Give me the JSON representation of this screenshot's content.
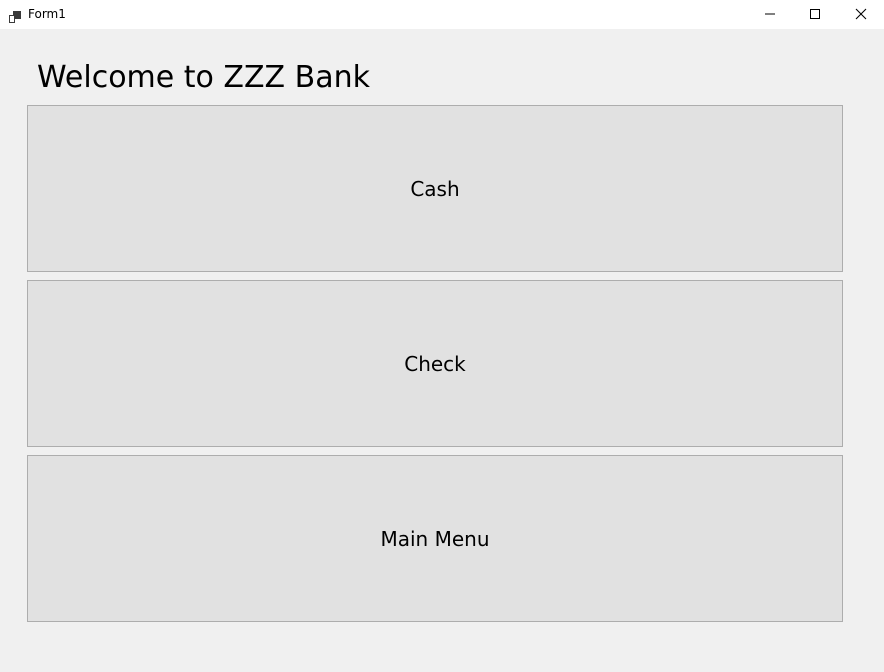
{
  "window": {
    "title": "Form1",
    "app_icon": "form-icon",
    "controls": {
      "minimize_icon": "minimize-icon",
      "maximize_icon": "maximize-icon",
      "close_icon": "close-icon"
    }
  },
  "main": {
    "heading": "Welcome to ZZZ Bank",
    "buttons": [
      {
        "label": "Cash"
      },
      {
        "label": "Check"
      },
      {
        "label": "Main Menu"
      }
    ]
  },
  "colors": {
    "window_background": "#f0f0f0",
    "titlebar_background": "#ffffff",
    "button_face": "#e1e1e1",
    "button_border": "#adadad",
    "text": "#000000"
  }
}
